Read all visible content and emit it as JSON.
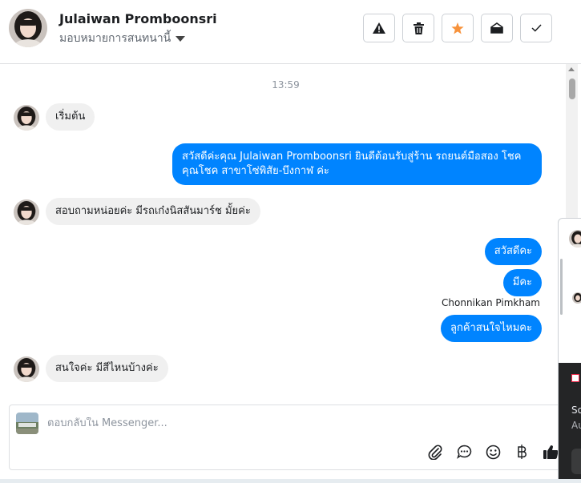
{
  "header": {
    "contact_name": "Julaiwan Promboonsri",
    "assign_label": "มอบหมายการสนทนานี้",
    "actions": [
      {
        "name": "report-button",
        "icon": "warning-icon"
      },
      {
        "name": "delete-button",
        "icon": "trash-icon"
      },
      {
        "name": "star-button",
        "icon": "star-icon",
        "color": "#f7923b"
      },
      {
        "name": "mark-unread-button",
        "icon": "envelope-open-icon"
      },
      {
        "name": "mark-done-button",
        "icon": "check-icon"
      }
    ]
  },
  "thread": {
    "timestamp": "13:59",
    "messages": [
      {
        "direction": "in",
        "text": "เริ่มต้น"
      },
      {
        "direction": "out",
        "text": "สวัสดีค่ะคุณ Julaiwan Promboonsri ยินดีต้อนรับสู่ร้าน รถยนต์มือสอง โชคคุณโชค สาขาโซ่พิสัย-บึงกาฬ ค่ะ"
      },
      {
        "direction": "in",
        "text": "สอบถามหน่อยค่ะ มีรถเก๋งนิสสันมาร์ช มั้ยค่ะ"
      },
      {
        "direction": "out",
        "text": "สวัสดีคะ"
      },
      {
        "direction": "out",
        "text": "มีคะ"
      },
      {
        "direction": "out",
        "sender": "Chonnikan Pimkham",
        "text": "ลูกค้าสนใจไหมคะ"
      },
      {
        "direction": "in",
        "text": "สนใจค่ะ มีสีไหนบ้างค่ะ"
      }
    ]
  },
  "composer": {
    "placeholder": "ตอบกลับใน Messenger...",
    "value": "",
    "tools": [
      "attachment-icon",
      "saved-reply-icon",
      "emoji-icon",
      "baht-icon",
      "thumbs-up-icon"
    ]
  },
  "popup": {
    "line1": "So",
    "line2": "Au"
  },
  "colors": {
    "outgoing_bubble": "#0084ff",
    "incoming_bubble": "#f0f0f0",
    "star": "#f7923b"
  }
}
